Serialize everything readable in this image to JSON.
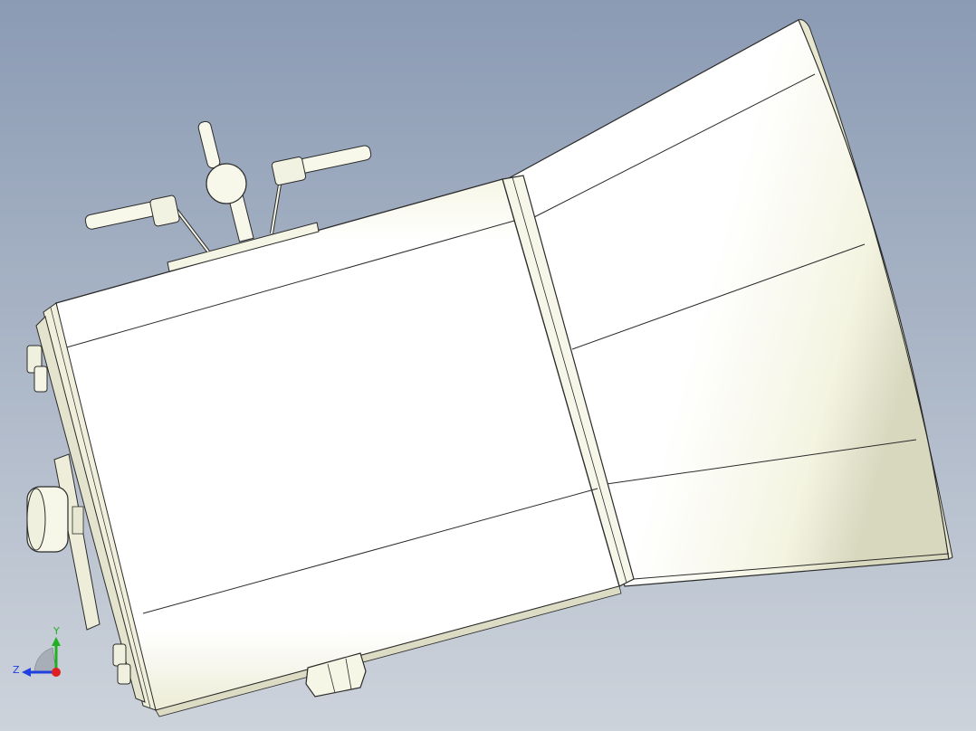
{
  "viewport": {
    "background_top": "#8b9bb4",
    "background_bottom": "#cdd3db"
  },
  "model": {
    "body_color": "#fffff0",
    "shade_color": "#e8e8cf",
    "edge_color": "#2b2b2b"
  },
  "triad": {
    "y_label": "Y",
    "z_label": "Z",
    "x_color": "#e02020",
    "y_color": "#22b022",
    "z_color": "#2040e0"
  }
}
